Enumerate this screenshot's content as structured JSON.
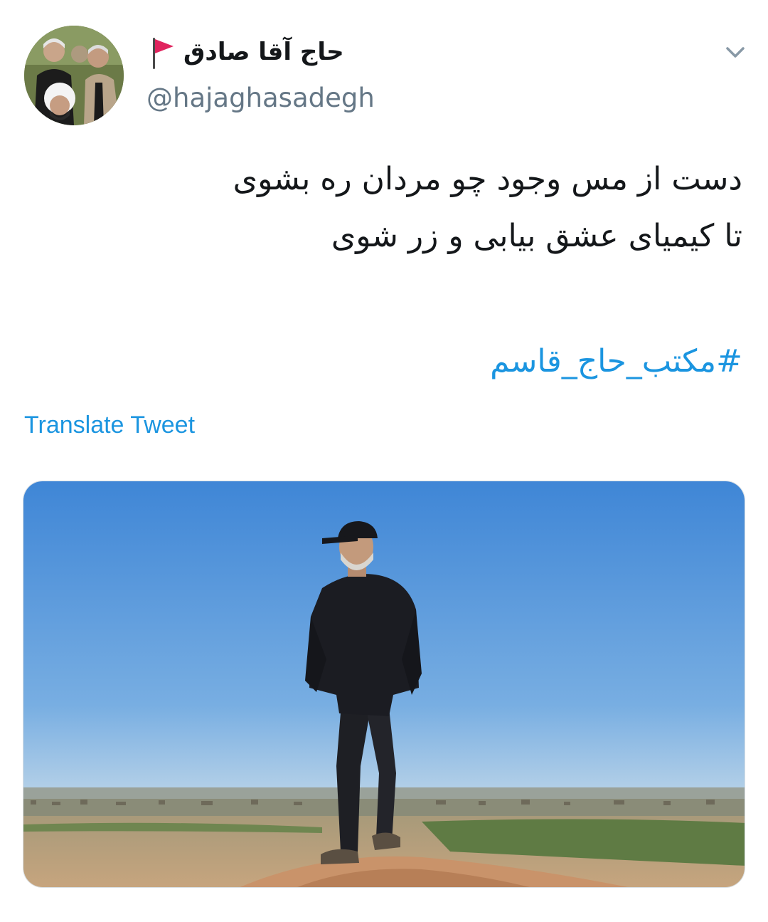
{
  "user": {
    "display_name": "حاج آقا صادق",
    "handle": "@hajaghasadegh"
  },
  "tweet": {
    "lines": [
      "دست از مس وجود چو مردان ره بشوی",
      "تا کیمیای عشق بیابی و زر شوی"
    ],
    "hashtag": "#مکتب_حاج_قاسم"
  },
  "actions": {
    "translate_label": "Translate Tweet"
  },
  "colors": {
    "link": "#1b95e0",
    "handle": "#657786",
    "text": "#14171a",
    "flag": "#e0245e"
  },
  "icons": {
    "more": "chevron-down-icon",
    "flag": "red-flag-icon"
  }
}
